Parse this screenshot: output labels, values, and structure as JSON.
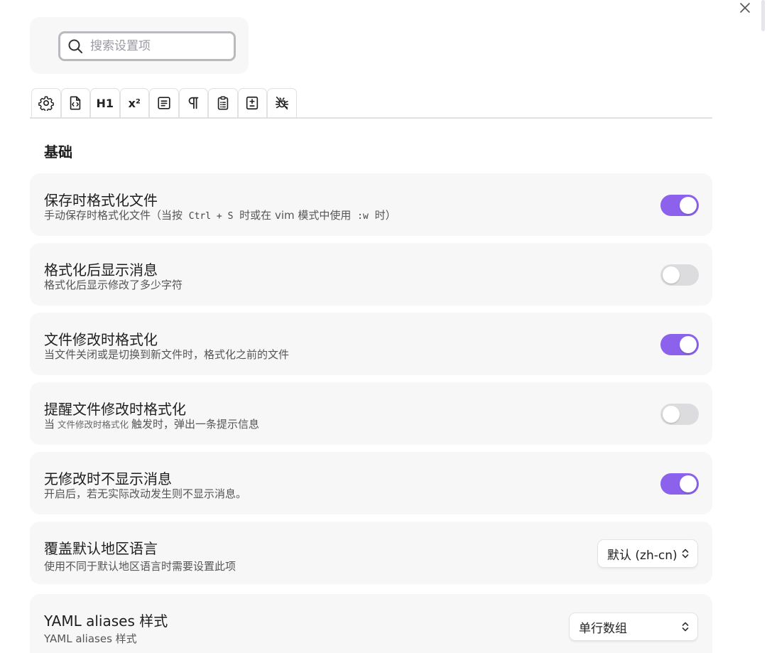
{
  "search": {
    "placeholder": "搜索设置项"
  },
  "tabs": [
    {
      "icon": "gear-icon"
    },
    {
      "icon": "file-code-icon"
    },
    {
      "icon": "heading-icon",
      "text": "H1"
    },
    {
      "icon": "superscript-icon",
      "text": "x²"
    },
    {
      "icon": "list-box-icon"
    },
    {
      "icon": "pilcrow-icon"
    },
    {
      "icon": "clipboard-icon"
    },
    {
      "icon": "plus-minus-box-icon"
    },
    {
      "icon": "bug-icon"
    }
  ],
  "section": {
    "title": "基础"
  },
  "settings": [
    {
      "title": "保存时格式化文件",
      "desc_before": "手动保存时格式化文件（当按 ",
      "desc_code1": "Ctrl + S",
      "desc_mid": " 时或在 vim 模式中使用 ",
      "desc_code2": ":w",
      "desc_after": " 时）",
      "enabled": true
    },
    {
      "title": "格式化后显示消息",
      "desc": "格式化后显示修改了多少字符",
      "enabled": false
    },
    {
      "title": "文件修改时格式化",
      "desc": "当文件关闭或是切换到新文件时，格式化之前的文件",
      "enabled": true
    },
    {
      "title": "提醒文件修改时格式化",
      "desc_before": "当",
      "desc_inline": "文件修改时格式化",
      "desc_after": "触发时，弹出一条提示信息",
      "enabled": false
    },
    {
      "title": "无修改时不显示消息",
      "desc": "开启后，若无实际改动发生则不显示消息。",
      "enabled": true
    },
    {
      "title": "覆盖默认地区语言",
      "desc": "使用不同于默认地区语言时需要设置此项",
      "select_value": "默认 (zh-cn)"
    },
    {
      "title": "YAML aliases 样式",
      "desc": "YAML aliases 样式",
      "select_value": "单行数组"
    }
  ],
  "colors": {
    "accent": "#8c62ec",
    "toggle_off": "#dcdcdf",
    "card_bg": "#f7f7f8"
  }
}
